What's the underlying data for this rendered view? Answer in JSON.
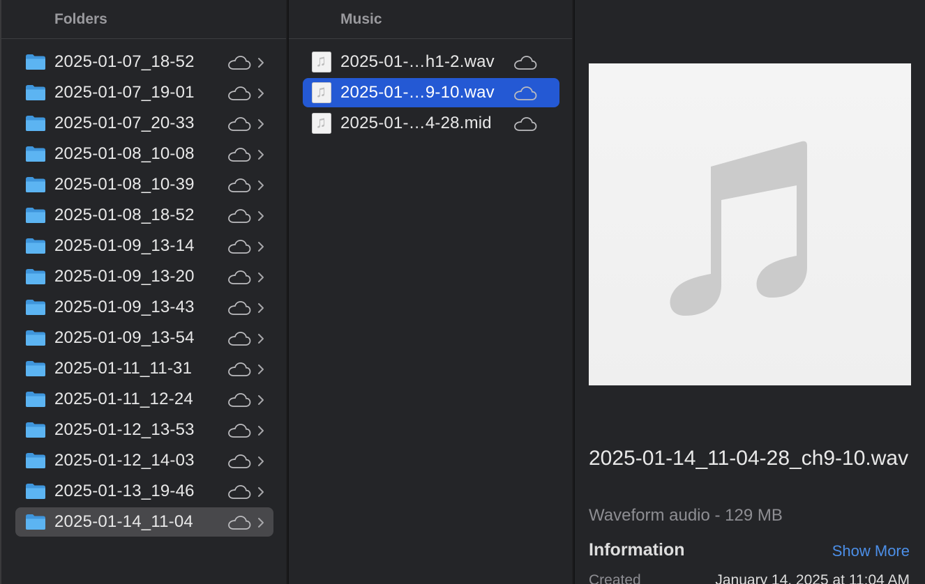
{
  "folders": {
    "header": "Folders",
    "items": [
      {
        "label": "2025-01-07_18-52"
      },
      {
        "label": "2025-01-07_19-01"
      },
      {
        "label": "2025-01-07_20-33"
      },
      {
        "label": "2025-01-08_10-08"
      },
      {
        "label": "2025-01-08_10-39"
      },
      {
        "label": "2025-01-08_18-52"
      },
      {
        "label": "2025-01-09_13-14"
      },
      {
        "label": "2025-01-09_13-20"
      },
      {
        "label": "2025-01-09_13-43"
      },
      {
        "label": "2025-01-09_13-54"
      },
      {
        "label": "2025-01-11_11-31"
      },
      {
        "label": "2025-01-11_12-24"
      },
      {
        "label": "2025-01-12_13-53"
      },
      {
        "label": "2025-01-12_14-03"
      },
      {
        "label": "2025-01-13_19-46"
      },
      {
        "label": "2025-01-14_11-04",
        "selected": true
      }
    ]
  },
  "music": {
    "header": "Music",
    "items": [
      {
        "label": "2025-01-…h1-2.wav"
      },
      {
        "label": "2025-01-…9-10.wav",
        "selected": true
      },
      {
        "label": "2025-01-…4-28.mid"
      }
    ]
  },
  "preview": {
    "filename": "2025-01-14_11-04-28_ch9-10.wav",
    "kind": "Waveform audio - 129 MB",
    "info_heading": "Information",
    "show_more": "Show More",
    "meta": {
      "label": "Created",
      "value": "January 14, 2025 at 11:04 AM"
    }
  },
  "icons": {
    "folder": "folder-icon",
    "file": "music-file-icon",
    "cloud": "icloud-icon",
    "chevron": "chevron-right-icon",
    "artwork": "music-note-icon"
  },
  "colors": {
    "folder_blue": "#4aa8ec",
    "selection_blue": "#2459d4",
    "link_blue": "#4c8fe8"
  }
}
